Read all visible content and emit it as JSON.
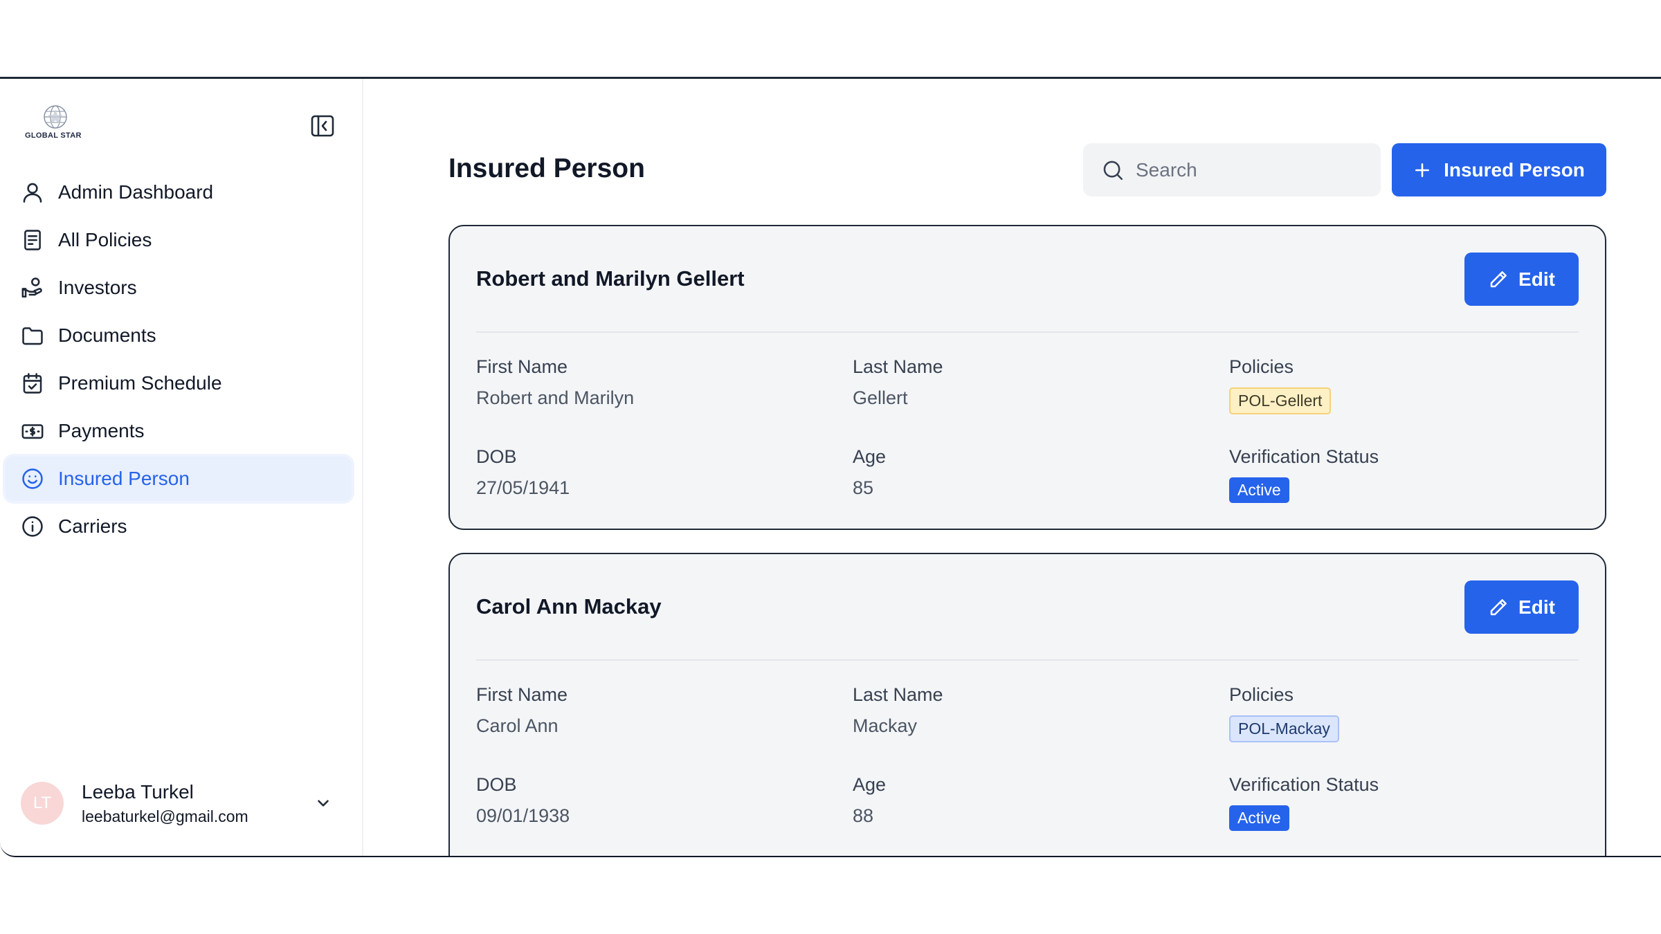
{
  "sidebar": {
    "logo_text": "GLOBAL STAR",
    "items": [
      {
        "label": "Admin Dashboard",
        "icon": "user-icon"
      },
      {
        "label": "All Policies",
        "icon": "document-icon"
      },
      {
        "label": "Investors",
        "icon": "hand-coins-icon"
      },
      {
        "label": "Documents",
        "icon": "folder-icon"
      },
      {
        "label": "Premium Schedule",
        "icon": "calendar-check-icon"
      },
      {
        "label": "Payments",
        "icon": "banknote-icon"
      },
      {
        "label": "Insured Person",
        "icon": "smile-icon",
        "active": true
      },
      {
        "label": "Carriers",
        "icon": "info-icon"
      }
    ],
    "user": {
      "initials": "LT",
      "name": "Leeba Turkel",
      "email": "leebaturkel@gmail.com"
    }
  },
  "main": {
    "title": "Insured Person",
    "search": {
      "placeholder": "Search"
    },
    "add_button_label": "Insured Person",
    "field_labels": {
      "first_name": "First Name",
      "last_name": "Last Name",
      "policies": "Policies",
      "dob": "DOB",
      "age": "Age",
      "verification_status": "Verification Status"
    },
    "edit_label": "Edit",
    "cards": [
      {
        "name": "Robert and Marilyn Gellert",
        "first_name": "Robert and Marilyn",
        "last_name": "Gellert",
        "policy": "POL-Gellert",
        "policy_tag_color": "#fdf0c4",
        "dob": "27/05/1941",
        "age": "85",
        "status": "Active"
      },
      {
        "name": "Carol Ann Mackay",
        "first_name": "Carol Ann",
        "last_name": "Mackay",
        "policy": "POL-Mackay",
        "policy_tag_color": "#dbe6fc",
        "dob": "09/01/1938",
        "age": "88",
        "status": "Active"
      }
    ]
  },
  "colors": {
    "accent": "#2563eb",
    "active_nav_bg": "#e8effd",
    "card_bg": "#f4f5f7"
  }
}
